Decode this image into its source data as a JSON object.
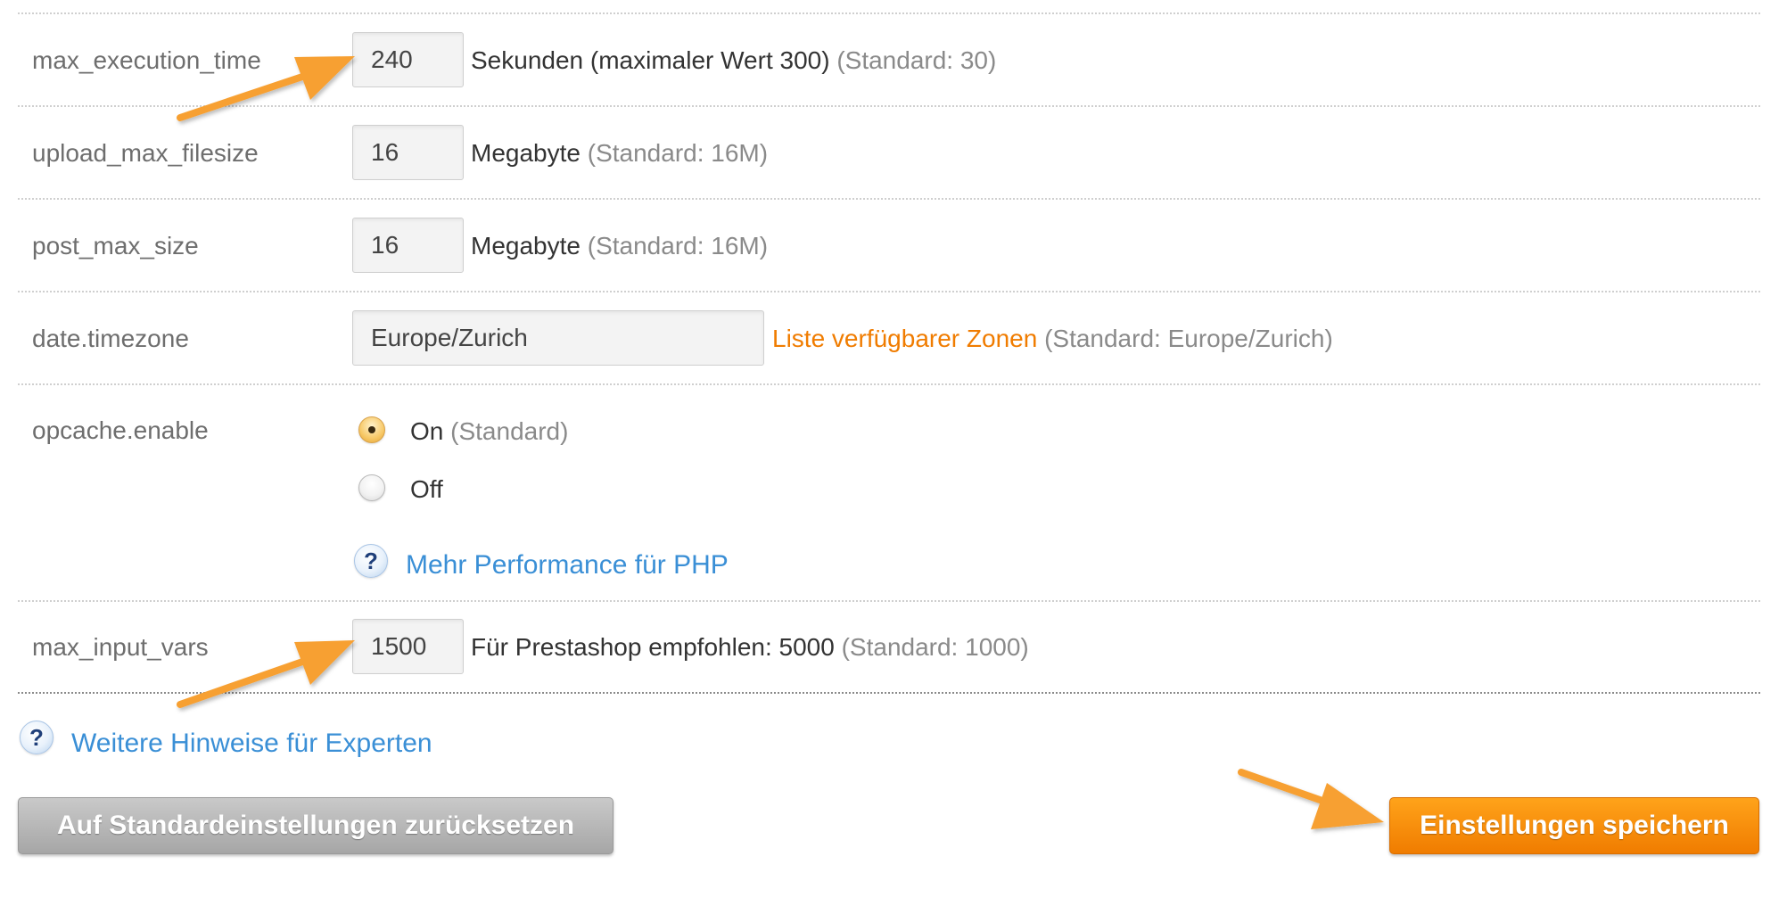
{
  "settings": {
    "max_execution_time": {
      "label": "max_execution_time",
      "value": "240",
      "description": "Sekunden (maximaler Wert 300)",
      "default": "(Standard: 30)"
    },
    "upload_max_filesize": {
      "label": "upload_max_filesize",
      "value": "16",
      "description": "Megabyte",
      "default": "(Standard: 16M)"
    },
    "post_max_size": {
      "label": "post_max_size",
      "value": "16",
      "description": "Megabyte",
      "default": "(Standard: 16M)"
    },
    "date_timezone": {
      "label": "date.timezone",
      "value": "Europe/Zurich",
      "link": "Liste verfügbarer Zonen",
      "default": "(Standard: Europe/Zurich)"
    },
    "opcache_enable": {
      "label": "opcache.enable",
      "option_on": "On",
      "option_on_default": "(Standard)",
      "option_off": "Off",
      "selected": "On",
      "help_icon_glyph": "?",
      "help_link": "Mehr Performance für PHP"
    },
    "max_input_vars": {
      "label": "max_input_vars",
      "value": "1500",
      "description": "Für Prestashop empfohlen: 5000",
      "default": "(Standard: 1000)"
    }
  },
  "expert_hint": {
    "icon_glyph": "?",
    "link": "Weitere Hinweise für Experten"
  },
  "buttons": {
    "reset_label": "Auf Standardeinstellungen zurücksetzen",
    "save_label": "Einstellungen speichern"
  },
  "colors": {
    "accent_orange": "#f07c00",
    "arrow_orange": "#f7a030",
    "link_blue": "#3a8fd6",
    "muted_text": "#8a8a8a"
  },
  "icons": [
    "help-icon",
    "arrow-annotation-icon",
    "radio-on",
    "radio-off"
  ]
}
